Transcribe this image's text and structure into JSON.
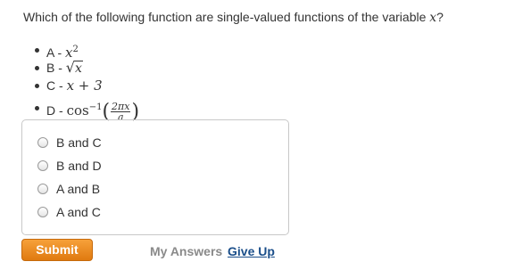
{
  "question": {
    "prefix": "Which of the following function are single-valued functions of the variable ",
    "variable": "x",
    "suffix": "?"
  },
  "options": [
    {
      "label": "A - ",
      "base": "x",
      "exp": "2"
    },
    {
      "label": "B - ",
      "radical": "√",
      "arg": "x"
    },
    {
      "label": "C - ",
      "expr": "x + 3"
    },
    {
      "label": "D - ",
      "func": "cos",
      "exp": "−1",
      "open": "(",
      "num": "2πx",
      "den": "a",
      "close": ")"
    }
  ],
  "choices": [
    "B and C",
    "B and D",
    "A and B",
    "A and C"
  ],
  "actions": {
    "submit": "Submit",
    "my_answers": "My Answers",
    "give_up": "Give Up"
  }
}
